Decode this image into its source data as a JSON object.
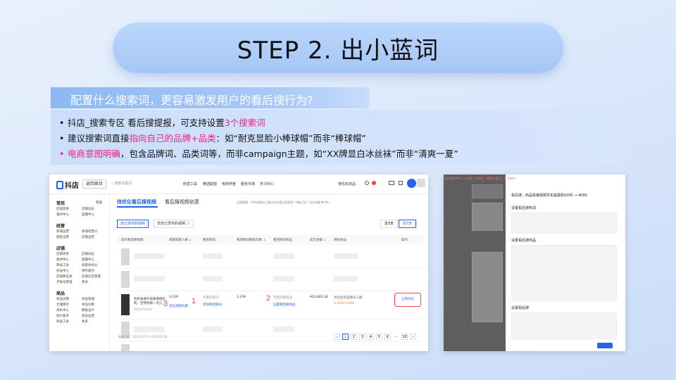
{
  "slide": {
    "title": "STEP 2. 出小蓝词",
    "question": "配置什么搜索词，更容易激发用户的看后搜行为?",
    "bullets": [
      {
        "plain1": "抖店_搜索专区 看后搜提报，可支持设置",
        "hl1": "3个搜索词",
        "plain2": ""
      },
      {
        "plain1": "建议搜索词直接",
        "hl1": "指向自己的品牌+品类",
        "plain2": "：如“耐克显脸小棒球帽”而非“棒球帽”"
      },
      {
        "hl1": "电商意图明确",
        "plain2": "，包含品牌词、品类词等，而非campaign主题，如“XX牌显白冰丝袜”而非“清爽一夏”"
      }
    ],
    "accent_color": "#e8287a",
    "annotation_color": "#ee4d4d"
  },
  "shop_ui": {
    "brand": "抖店",
    "home_button": "返回首页",
    "search_placeholder": "搜索关键词",
    "top_nav": [
      "经营工具",
      "精选联盟",
      "电商罗盘",
      "服务市场",
      "学习中心"
    ],
    "top_right": "待优化商品",
    "sidebar": {
      "groups": [
        {
          "title": "常用",
          "extra": "管理",
          "items": [
            "店铺装修",
            "店铺动态",
            "素材中心",
            "直播中心"
          ]
        },
        {
          "title": "经营",
          "items": [
            "商城运营",
            "商城经营分",
            "搜索运营",
            "店铺运营"
          ]
        },
        {
          "title": "店铺",
          "items": [
            "店铺装修",
            "店铺动态",
            "素材中心",
            "直播中心",
            "审核工具",
            "商家体验分",
            "权益中心",
            "保险服务",
            "店铺保证金",
            "店铺信息管理",
            "子账号管理",
            "更多"
          ]
        },
        {
          "title": "商品",
          "items": [
            "商品创建",
            "商品管理",
            "仓储库存",
            "商品诊断",
            "商机中心",
            "模板设计",
            "绘价服务",
            "商品运营",
            "商品工具",
            "更多"
          ]
        }
      ]
    },
    "tabs": [
      "待优化看后搜视频",
      "看后搜视频创意"
    ],
    "notice": "近期提醒：XXX视频达已通过优化看后搜视频 “冰箱卫拉” 成交金额 ▼ 0% ›",
    "notice_right": "去看看视频创意：看全部视频",
    "sub_tabs": [
      "自己发布的视频",
      "非自己发布的视频 ⓘ"
    ],
    "date_buttons": [
      "近3天",
      "近7天"
    ],
    "columns": [
      "您的看后搜视频",
      "视频观看人数 ↓",
      "看后搜词",
      "看后搜词搜索次数 ↓",
      "看后搜的商品",
      "成交金额 ↓",
      "预估收益",
      "操作"
    ],
    "row": {
      "video_title": "有机会格外优质真假红利，还特优质一点儿...",
      "video_date": "2024/10/24",
      "views": "9,239",
      "views_link": "优化视频标题",
      "keyword_state": "无看后搜词",
      "keyword_link": "添加看后搜词",
      "search_count": "1,239",
      "goods_state": "无看后搜商品",
      "goods_link": "设置看后搜商品",
      "gmv": "¥20,883.34",
      "estimate_label": "优化后商品曝光人群",
      "estimate_value": "¥ $625-1000",
      "action": "立即优化"
    },
    "annotations": [
      "1",
      "2",
      "3"
    ],
    "footer_note": "数据日期：2024/11/25~2024/11/30",
    "pages": [
      "‹",
      "1",
      "2",
      "3",
      "4",
      "5",
      "6",
      "...",
      "10",
      "›"
    ]
  },
  "phone_ui": {
    "banner": "在抖音APP中，左侧栏、右侧栏「视频小蓝词」入口说明",
    "header": "看后搜，商品看播视频优化提报如1000 → 4000",
    "section1": "设置看后搜热词",
    "section2": "设置看后搜商品",
    "section3": "设置看后搜"
  }
}
